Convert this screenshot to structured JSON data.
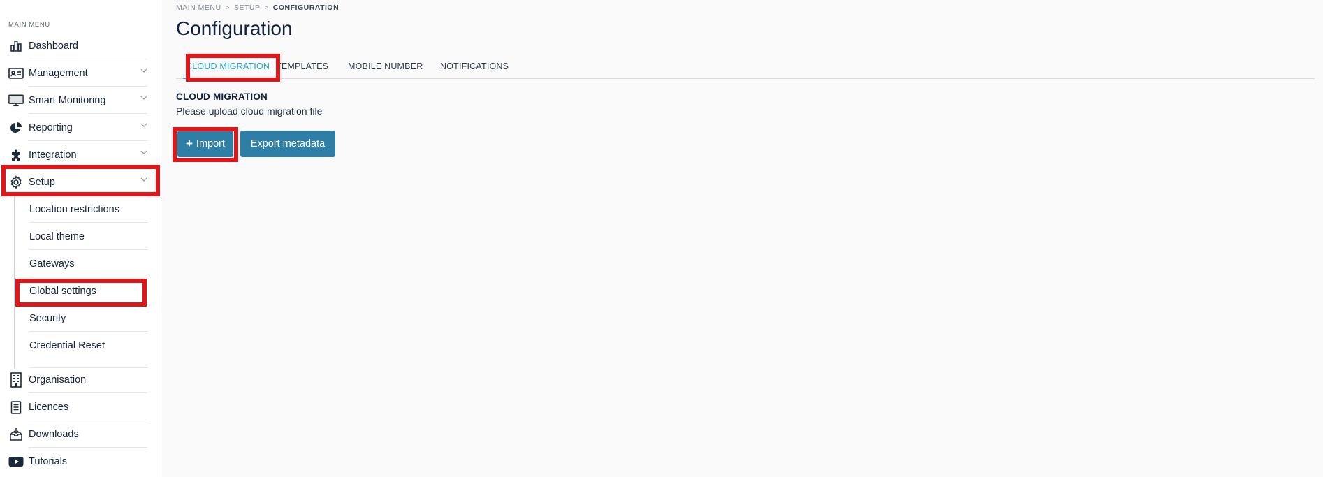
{
  "sidebar": {
    "caption": "MAIN MENU",
    "items": [
      {
        "label": "Dashboard"
      },
      {
        "label": "Management"
      },
      {
        "label": "Smart Monitoring"
      },
      {
        "label": "Reporting"
      },
      {
        "label": "Integration"
      },
      {
        "label": "Setup"
      },
      {
        "label": "Organisation"
      },
      {
        "label": "Licences"
      },
      {
        "label": "Downloads"
      },
      {
        "label": "Tutorials"
      }
    ],
    "setup_sub": [
      {
        "label": "Location restrictions"
      },
      {
        "label": "Local theme"
      },
      {
        "label": "Gateways"
      },
      {
        "label": "Global settings"
      },
      {
        "label": "Security"
      },
      {
        "label": "Credential Reset"
      }
    ]
  },
  "breadcrumb": {
    "items": [
      "MAIN MENU",
      "SETUP",
      "CONFIGURATION"
    ]
  },
  "page": {
    "title": "Configuration"
  },
  "tabs": [
    {
      "label": "CLOUD MIGRATION",
      "active": true
    },
    {
      "label": "TEMPLATES"
    },
    {
      "label": "MOBILE NUMBER"
    },
    {
      "label": "NOTIFICATIONS"
    }
  ],
  "section": {
    "title": "CLOUD MIGRATION",
    "description": "Please upload cloud migration file"
  },
  "actions": {
    "import_label": "Import",
    "export_label": "Export metadata"
  },
  "colors": {
    "accent": "#1fa6c9",
    "button": "#2f7ea5",
    "highlight": "#e0161b"
  }
}
